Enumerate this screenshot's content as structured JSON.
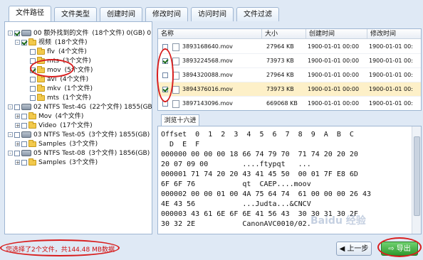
{
  "tabs": [
    {
      "label": "文件路径"
    },
    {
      "label": "文件类型"
    },
    {
      "label": "创建时间"
    },
    {
      "label": "修改时间"
    },
    {
      "label": "访问时间"
    },
    {
      "label": "文件过滤"
    }
  ],
  "tree": [
    {
      "label": "00 额外找到的文件",
      "info": "(18个文件)  0(GB)  0",
      "checked": true,
      "type": "drive",
      "expander": "-"
    },
    {
      "label": "视频",
      "info": "(18个文件)",
      "checked": true,
      "type": "folder",
      "expander": "-"
    },
    {
      "label": "flv",
      "info": "(4个文件)",
      "checked": false,
      "type": "folder",
      "expander": ""
    },
    {
      "label": "mts",
      "info": "(3个文件)",
      "checked": false,
      "type": "folder",
      "expander": ""
    },
    {
      "label": "mov",
      "info": "(5个文件)",
      "checked": true,
      "type": "folder",
      "expander": ""
    },
    {
      "label": "avi",
      "info": "(4个文件)",
      "checked": false,
      "type": "folder",
      "expander": ""
    },
    {
      "label": "mkv",
      "info": "(1个文件)",
      "checked": false,
      "type": "folder",
      "expander": ""
    },
    {
      "label": "mts",
      "info": "(1个文件)",
      "checked": false,
      "type": "folder",
      "expander": ""
    },
    {
      "label": "02 NTFS Test-4G",
      "info": "(22个文件)  1855(GB)  0",
      "checked": false,
      "type": "drive",
      "expander": "-"
    },
    {
      "label": "Mov",
      "info": "(4个文件)",
      "checked": false,
      "type": "folder",
      "expander": "+"
    },
    {
      "label": "Video",
      "info": "(17个文件)",
      "checked": false,
      "type": "folder",
      "expander": "+"
    },
    {
      "label": "03 NTFS Test-05",
      "info": "(3个文件)  1855(GB)  0",
      "checked": false,
      "type": "drive",
      "expander": "-"
    },
    {
      "label": "Samples",
      "info": "(3个文件)",
      "checked": false,
      "type": "folder",
      "expander": "+"
    },
    {
      "label": "05 NTFS Test-08",
      "info": "(3个文件)  1856(GB)  0",
      "checked": false,
      "type": "drive",
      "expander": "-"
    },
    {
      "label": "Samples",
      "info": "(3个文件)",
      "checked": false,
      "type": "folder",
      "expander": "+"
    }
  ],
  "file_list": {
    "columns": [
      "名称",
      "大小",
      "创建时间",
      "修改时间"
    ],
    "rows": [
      {
        "name": "3893168640.mov",
        "size": "27964 KB",
        "created": "1900-01-01 00:00",
        "modified": "1900-01-01 00:",
        "checked": false,
        "selected": false
      },
      {
        "name": "3893224568.mov",
        "size": "73973 KB",
        "created": "1900-01-01 00:00",
        "modified": "1900-01-01 00:",
        "checked": true,
        "selected": false
      },
      {
        "name": "3894320088.mov",
        "size": "27964 KB",
        "created": "1900-01-01 00:00",
        "modified": "1900-01-01 00:",
        "checked": false,
        "selected": false
      },
      {
        "name": "3894376016.mov",
        "size": "73973 KB",
        "created": "1900-01-01 00:00",
        "modified": "1900-01-01 00:",
        "checked": true,
        "selected": true
      },
      {
        "name": "3897143096.mov",
        "size": "669068 KB",
        "created": "1900-01-01 00:00",
        "modified": "1900-01-01 00:",
        "checked": false,
        "selected": false
      }
    ]
  },
  "hex_view": {
    "tab_label": "浏览十六进制",
    "lines": [
      "Offset  0  1  2  3  4  5  6  7  8  9  A  B  C",
      "  D  E  F",
      "000000 00 00 00 18 66 74 79 70  71 74 20 20 20",
      "20 07 09 00        ....ftypqt   ...",
      "000001 71 74 20 20 43 41 45 50  00 01 7F E8 6D",
      "6F 6F 76           qt  CAEP....moov",
      "000002 00 00 01 00 4A 75 64 74  61 00 00 00 26 43",
      "4E 43 56           ...Judta...&CNCV",
      "000003 43 61 6E 6F 6E 41 56 43  30 30 31 30 2F",
      "30 32 2E           CanonAVC0010/02."
    ]
  },
  "status_text": "您选择了2个文件，共144.48 MB数据",
  "buttons": {
    "prev": "上一步",
    "export": "导出"
  },
  "watermark": "Baidu 经验",
  "colors": {
    "highlight_red": "#d81e1e",
    "selected_row": "#fdf0c8",
    "export_green": "#2f9a2f"
  }
}
